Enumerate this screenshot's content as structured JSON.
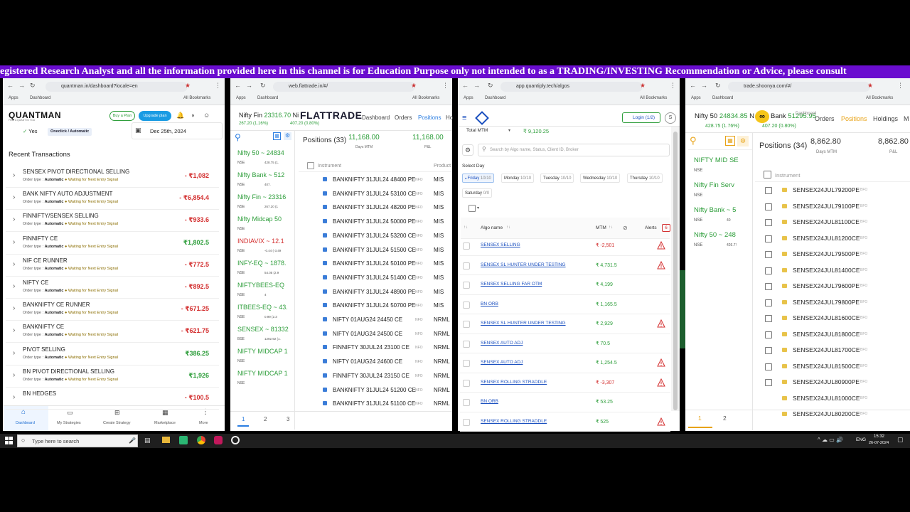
{
  "banner": "egistered Research Analyst and all the information provided here in this channel is for Education Purpose only not intended to as a TRADING/INVESTING Recommendation or Advice, please consult",
  "common": {
    "apps": "Apps",
    "dashboard_bm": "Dashboard",
    "all_bookmarks": "All Bookmarks"
  },
  "w1": {
    "url": "quantman.in/dashboard?locale=en",
    "logo": "QUANTMAN",
    "logo_tag": "FIND A QUANT IN YOU",
    "buy_plan": "Buy a Plan",
    "upgrade_plan": "Upgrade plan",
    "yes_label": "Yes",
    "mode_badge": "Oneclick / Automatic",
    "date": "Dec 25th, 2024",
    "section_title": "Recent Transactions",
    "order_type_label": "Order type :",
    "transactions": [
      {
        "name": "SENSEX PIVOT DIRECTIONAL SELLING",
        "type": "Automatic",
        "status": "Waiting for Next Entry Signal",
        "amount": "- ₹1,082",
        "sign": "neg"
      },
      {
        "name": "BANK NIFTY AUTO ADJUSTMENT",
        "type": "Automatic",
        "status": "Waiting for Next Entry Signal",
        "amount": "- ₹6,854.4",
        "sign": "neg"
      },
      {
        "name": "FINNIFTY/SENSEX SELLING",
        "type": "Automatic",
        "status": "Waiting for Next Entry Signal",
        "amount": "- ₹933.6",
        "sign": "neg"
      },
      {
        "name": "FINNIFTY CE",
        "type": "Automatic",
        "status": "Waiting for Next Entry Signal",
        "amount": "₹1,802.5",
        "sign": "pos"
      },
      {
        "name": "NIF CE RUNNER",
        "type": "Automatic",
        "status": "Waiting for Next Entry Signal",
        "amount": "- ₹772.5",
        "sign": "neg"
      },
      {
        "name": "NIFTY CE",
        "type": "Automatic",
        "status": "Waiting for Next Entry Signal",
        "amount": "- ₹892.5",
        "sign": "neg"
      },
      {
        "name": "BANKNIFTY CE RUNNER",
        "type": "Automatic",
        "status": "Waiting for Next Entry Signal",
        "amount": "- ₹671.25",
        "sign": "neg"
      },
      {
        "name": "BANKNIFTY CE",
        "type": "Automatic",
        "status": "Waiting for Next Entry Signal",
        "amount": "- ₹621.75",
        "sign": "neg"
      },
      {
        "name": "PIVOT SELLING",
        "type": "Automatic",
        "status": "Waiting for Next Entry Signal",
        "amount": "₹386.25",
        "sign": "pos"
      },
      {
        "name": "BN PIVOT DIRECTIONAL SELLING",
        "type": "Automatic",
        "status": "Waiting for Next Entry Signal",
        "amount": "₹1,926",
        "sign": "pos"
      },
      {
        "name": "BN HEDGES",
        "type": "",
        "status": "",
        "amount": "- ₹100.5",
        "sign": "neg"
      }
    ],
    "nav": [
      "Dashboard",
      "My Strategies",
      "Create Strategy",
      "Marketplace",
      "More"
    ]
  },
  "w2": {
    "url": "web.flattrade.in/#/",
    "ticker1_name": "Nifty Fin",
    "ticker1_val": "23316.70",
    "ticker1_chg": "267.20 (1.16%)",
    "ticker2_name": "Nif",
    "ticker2_chg": "407.20 (0.80%)",
    "logo": "FLATTRADE",
    "nav": [
      "Dashboard",
      "Orders",
      "Positions",
      "Ho"
    ],
    "watch": [
      {
        "name": "Nifty 50",
        "val": "24834",
        "ex": "NSE",
        "chg": "428.75 (1.",
        "cls": "green"
      },
      {
        "name": "Nifty Bank",
        "val": "512",
        "ex": "NSE",
        "chg": "407.",
        "cls": "green"
      },
      {
        "name": "Nifty Fin",
        "val": "23316",
        "ex": "NSE",
        "chg": "267.20 (1",
        "cls": "green"
      },
      {
        "name": "Nifty Midcap 50",
        "val": "",
        "ex": "NSE",
        "chg": "",
        "cls": "green"
      },
      {
        "name": "INDIAVIX",
        "val": "12.1",
        "ex": "NSE",
        "chg": "-0.44 (-3.49",
        "cls": "red"
      },
      {
        "name": "INFY-EQ",
        "val": "1878.",
        "ex": "NSE",
        "chg": "54.05 (2.9",
        "cls": "green"
      },
      {
        "name": "NIFTYBEES-EQ",
        "val": "",
        "ex": "NSE",
        "chg": "4",
        "cls": "green"
      },
      {
        "name": "ITBEES-EQ",
        "val": "43.",
        "ex": "NSE",
        "chg": "0.99 (2.3",
        "cls": "green"
      },
      {
        "name": "SENSEX",
        "val": "81332",
        "ex": "BSE",
        "chg": "1292.92 (1.",
        "cls": "green"
      },
      {
        "name": "NIFTY MIDCAP 1",
        "val": "",
        "ex": "NSE",
        "chg": "",
        "cls": "green"
      },
      {
        "name": "NIFTY MIDCAP 1",
        "val": "",
        "ex": "NSE",
        "chg": "",
        "cls": "green"
      }
    ],
    "positions_label": "Positions",
    "positions_count": "(33)",
    "days_mtm_val": "11,168.00",
    "days_mtm_label": "Days MTM",
    "pl_val": "11,168.00",
    "pl_label": "P&L",
    "col_instrument": "Instrument",
    "col_product": "Product",
    "rows": [
      {
        "n": "BANKNIFTY 31JUL24 48400 PE",
        "x": "NFO",
        "p": "MIS"
      },
      {
        "n": "BANKNIFTY 31JUL24 53100 CE",
        "x": "NFO",
        "p": "MIS"
      },
      {
        "n": "BANKNIFTY 31JUL24 48200 PE",
        "x": "NFO",
        "p": "MIS"
      },
      {
        "n": "BANKNIFTY 31JUL24 50000 PE",
        "x": "NFO",
        "p": "MIS"
      },
      {
        "n": "BANKNIFTY 31JUL24 53200 CE",
        "x": "NFO",
        "p": "MIS"
      },
      {
        "n": "BANKNIFTY 31JUL24 51500 CE",
        "x": "NFO",
        "p": "MIS"
      },
      {
        "n": "BANKNIFTY 31JUL24 50100 PE",
        "x": "NFO",
        "p": "MIS"
      },
      {
        "n": "BANKNIFTY 31JUL24 51400 CE",
        "x": "NFO",
        "p": "MIS"
      },
      {
        "n": "BANKNIFTY 31JUL24 48900 PE",
        "x": "NFO",
        "p": "MIS"
      },
      {
        "n": "BANKNIFTY 31JUL24 50700 PE",
        "x": "NFO",
        "p": "MIS"
      },
      {
        "n": "NIFTY 01AUG24 24450 CE",
        "x": "NFO",
        "p": "NRML"
      },
      {
        "n": "NIFTY 01AUG24 24500 CE",
        "x": "NFO",
        "p": "NRML"
      },
      {
        "n": "FINNIFTY 30JUL24 23100 CE",
        "x": "NFO",
        "p": "NRML"
      },
      {
        "n": "NIFTY 01AUG24 24600 CE",
        "x": "NFO",
        "p": "NRML"
      },
      {
        "n": "FINNIFTY 30JUL24 23150 CE",
        "x": "NFO",
        "p": "NRML"
      },
      {
        "n": "BANKNIFTY 31JUL24 51200 CE",
        "x": "NFO",
        "p": "NRML"
      },
      {
        "n": "BANKNIFTY 31JUL24 51100 CE",
        "x": "NFO",
        "p": "NRML"
      }
    ],
    "pages": [
      "1",
      "2",
      "3"
    ]
  },
  "w3": {
    "url": "app.quantiply.tech/algos",
    "login": "Login (1/2)",
    "avatar": "S",
    "total_mtm_label": "Total MTM",
    "total_mtm_val": "₹ 9,120.25",
    "search_placeholder": "Search by Algo name, Status, Client ID, Broker",
    "select_day": "Select Day",
    "days": [
      {
        "d": "Friday",
        "c": "10/10",
        "active": true
      },
      {
        "d": "Monday",
        "c": "10/10",
        "active": false
      },
      {
        "d": "Tuesday",
        "c": "10/10",
        "active": false
      },
      {
        "d": "Wednesday",
        "c": "10/10",
        "active": false
      },
      {
        "d": "Thursday",
        "c": "10/10",
        "active": false
      },
      {
        "d": "Saturday",
        "c": "0/0",
        "active": false
      }
    ],
    "col_algo": "Algo name",
    "col_mtm": "MTM",
    "col_alerts": "Alerts",
    "alerts_badge": "6",
    "algos": [
      {
        "n": "SENSEX SELLING",
        "m": "₹ -2,501",
        "cls": "red",
        "warn": true
      },
      {
        "n": "SENSEX SL HUNTER UNDER TESTING",
        "m": "₹ 4,731.5",
        "cls": "green",
        "warn": true
      },
      {
        "n": "SENSEX SELLING FAR OTM",
        "m": "₹ 4,199",
        "cls": "green",
        "warn": false
      },
      {
        "n": "BN ORB",
        "m": "₹ 1,165.5",
        "cls": "green",
        "warn": false
      },
      {
        "n": "SENSEX SL HUNTER UNDER TESTING",
        "m": "₹ 2,929",
        "cls": "green",
        "warn": true
      },
      {
        "n": "SENSEX AUTO ADJ",
        "m": "₹ 70.5",
        "cls": "green",
        "warn": false
      },
      {
        "n": "SENSEX AUTO ADJ",
        "m": "₹ 1,254.5",
        "cls": "green",
        "warn": true
      },
      {
        "n": "SENSEX ROLLING STRADDLE",
        "m": "₹ -3,307",
        "cls": "red",
        "warn": true
      },
      {
        "n": "BN ORB",
        "m": "₹ 53.25",
        "cls": "green",
        "warn": false
      },
      {
        "n": "SENSEX ROLLING STRADDLE",
        "m": "₹ 525",
        "cls": "green",
        "warn": true
      }
    ]
  },
  "w4": {
    "url": "trade.shoonya.com/#/",
    "t1_name": "Nifty 50",
    "t1_val": "24834.85",
    "t1_chg": "428.75 (1.76%)",
    "t2_name": "N",
    "t2_name_b": "Bank",
    "t2_val": "51295.95",
    "t2_chg": "407.20 (0.80%)",
    "nav": [
      "Dashboard",
      "Orders",
      "Positions",
      "Holdings",
      "M"
    ],
    "watch": [
      {
        "name": "NIFTY MID SE",
        "ex": "NSE",
        "v": ""
      },
      {
        "name": "Nifty Fin Serv",
        "ex": "NSE",
        "v": ""
      },
      {
        "name": "Nifty Bank ~ 5",
        "ex": "NSE",
        "v": "40"
      },
      {
        "name": "Nifty 50 ~ 248",
        "ex": "NSE",
        "v": "426.7!"
      }
    ],
    "positions_label": "Positions",
    "positions_count": "(34)",
    "days_mtm_val": "8,862.80",
    "days_mtm_label": "Days MTM",
    "pl_val": "8,862.80",
    "pl_label": "P&L",
    "col_instrument": "Instrument",
    "rows": [
      {
        "n": "SENSEX24JUL79200PE",
        "x": "BFO"
      },
      {
        "n": "SENSEX24JUL79100PE",
        "x": "BFO"
      },
      {
        "n": "SENSEX24JUL81100CE",
        "x": "BFO"
      },
      {
        "n": "SENSEX24JUL81200CE",
        "x": "BFO"
      },
      {
        "n": "SENSEX24JUL79500PE",
        "x": "BFO"
      },
      {
        "n": "SENSEX24JUL81400CE",
        "x": "BFO"
      },
      {
        "n": "SENSEX24JUL79600PE",
        "x": "BFO"
      },
      {
        "n": "SENSEX24JUL79800PE",
        "x": "BFO"
      },
      {
        "n": "SENSEX24JUL81600CE",
        "x": "BFO"
      },
      {
        "n": "SENSEX24JUL81800CE",
        "x": "BFO"
      },
      {
        "n": "SENSEX24JUL81700CE",
        "x": "BFO"
      },
      {
        "n": "SENSEX24JUL81500CE",
        "x": "BFO"
      },
      {
        "n": "SENSEX24JUL80900PE",
        "x": "BFO"
      },
      {
        "n": "SENSEX24JUL81000CE",
        "x": "BFO"
      },
      {
        "n": "SENSEX24JUL80200CE",
        "x": "BFO"
      }
    ],
    "pages": [
      "1",
      "2"
    ]
  },
  "taskbar": {
    "search": "Type here to search",
    "lang": "ENG",
    "time": "15:32",
    "date": "26-07-2024"
  }
}
